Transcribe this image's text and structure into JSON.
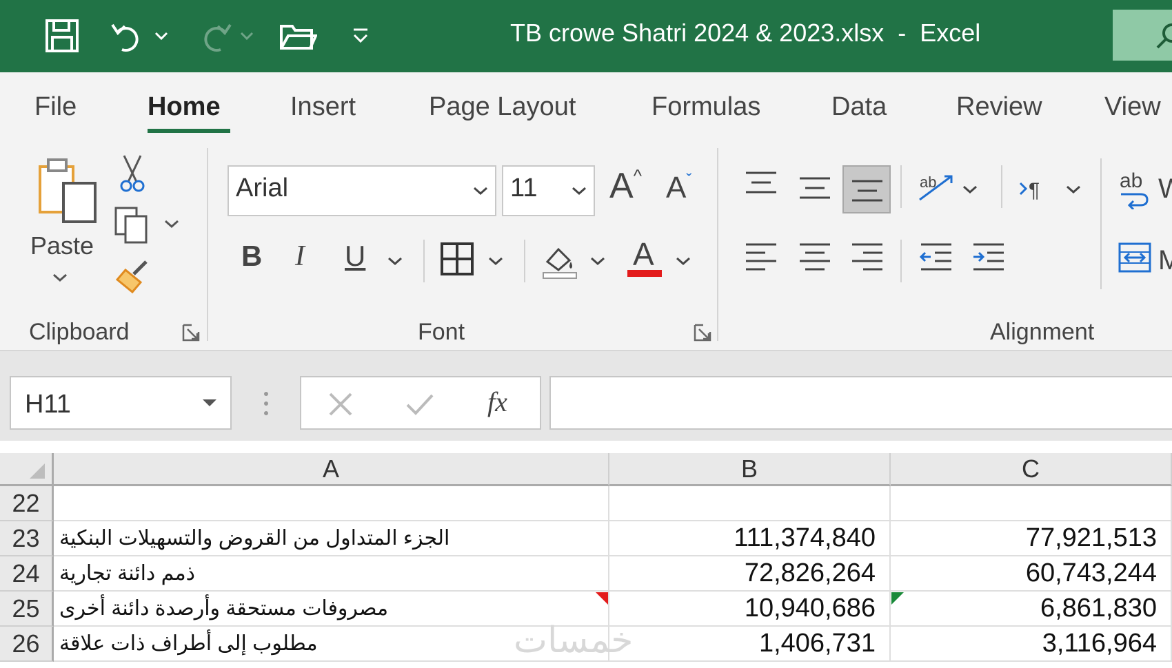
{
  "window": {
    "title": "TB crowe Shatri 2024 & 2023.xlsx  -  Excel",
    "qat": [
      "save-icon",
      "undo-icon",
      "redo-icon",
      "open-folder-icon",
      "customize-qat-icon"
    ]
  },
  "ribbon": {
    "tabs": [
      "File",
      "Home",
      "Insert",
      "Page Layout",
      "Formulas",
      "Data",
      "Review",
      "View"
    ],
    "active_tab": "Home",
    "clipboard": {
      "paste_label": "Paste",
      "group_label": "Clipboard"
    },
    "font": {
      "family": "Arial",
      "size": "11",
      "group_label": "Font",
      "bold": "B",
      "italic": "I",
      "underline": "U",
      "font_color_letter": "A",
      "grow": "A",
      "shrink": "A",
      "font_color": "#e31b1b"
    },
    "alignment": {
      "group_label": "Alignment",
      "wrap_prefix": "ab",
      "wrap_cut": "W",
      "merge_cut": "M"
    }
  },
  "formula_bar": {
    "name_box": "H11",
    "formula": "",
    "fx": "fx"
  },
  "sheet": {
    "columns": [
      "A",
      "B",
      "C"
    ],
    "rows": [
      {
        "num": "22",
        "a": "",
        "b": "",
        "c": ""
      },
      {
        "num": "23",
        "a": "الجزء المتداول من القروض والتسهيلات البنكية",
        "b": "111,374,840",
        "c": "77,921,513"
      },
      {
        "num": "24",
        "a": "ذمم دائنة تجارية",
        "b": "72,826,264",
        "c": "60,743,244"
      },
      {
        "num": "25",
        "a": "مصروفات مستحقة وأرصدة دائنة أخرى",
        "b": "10,940,686",
        "c": "6,861,830"
      },
      {
        "num": "26",
        "a": "مطلوب إلى أطراف ذات علاقة",
        "b": "1,406,731",
        "c": "3,116,964"
      }
    ]
  },
  "watermark": "خمسات",
  "colors": {
    "excel_green": "#217346",
    "ribbon_bg": "#f3f3f3"
  }
}
